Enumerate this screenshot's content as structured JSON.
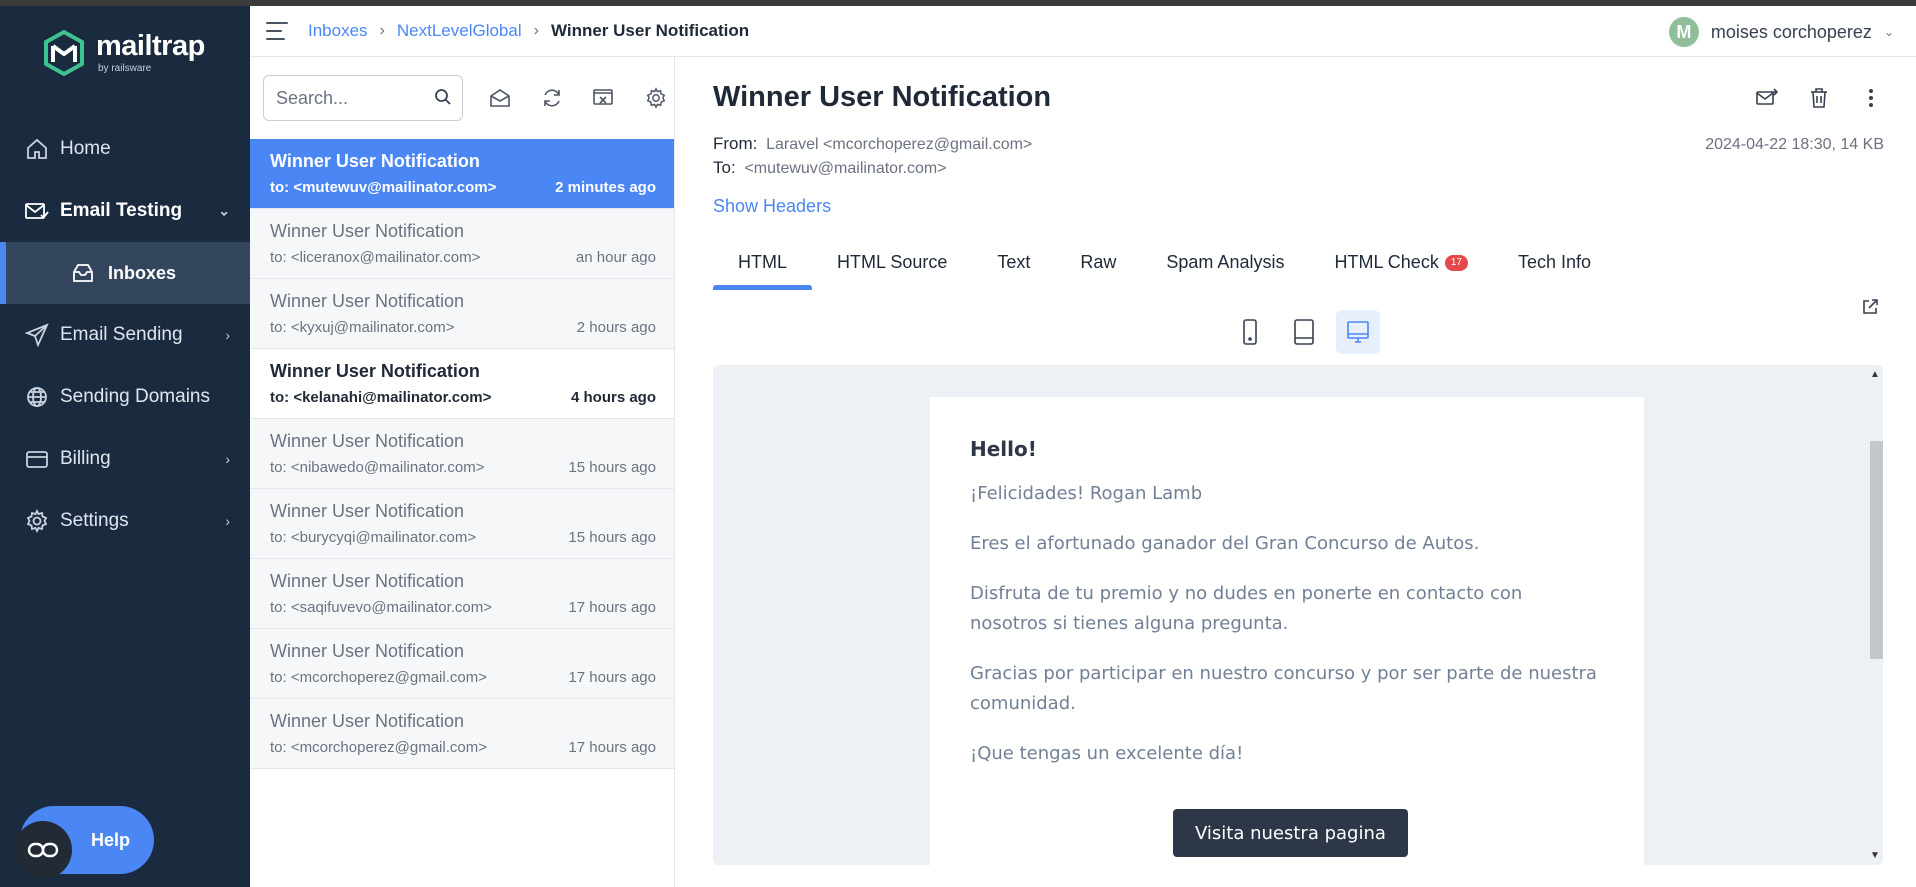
{
  "brand": {
    "name": "mailtrap",
    "sub": "by railsware",
    "accent": "#4a87f5",
    "sidebar_bg": "#1b2b3f"
  },
  "sidebar": {
    "items": [
      {
        "label": "Home",
        "icon": "home-icon"
      },
      {
        "label": "Email Testing",
        "icon": "email-testing-icon",
        "expanded": true
      },
      {
        "label": "Inboxes",
        "icon": "inbox-icon",
        "active": true
      },
      {
        "label": "Email Sending",
        "icon": "send-icon"
      },
      {
        "label": "Sending Domains",
        "icon": "globe-icon"
      },
      {
        "label": "Billing",
        "icon": "billing-icon"
      },
      {
        "label": "Settings",
        "icon": "gear-icon"
      }
    ],
    "help_label": "Help"
  },
  "header": {
    "breadcrumb": [
      "Inboxes",
      "NextLevelGlobal",
      "Winner User Notification"
    ],
    "user_initial": "M",
    "user_name": "moises corchoperez"
  },
  "list": {
    "search_placeholder": "Search...",
    "messages": [
      {
        "subject": "Winner User Notification",
        "to": "to: <mutewuv@mailinator.com>",
        "time": "2 minutes ago",
        "state": "selected"
      },
      {
        "subject": "Winner User Notification",
        "to": "to: <liceranox@mailinator.com>",
        "time": "an hour ago",
        "state": "read"
      },
      {
        "subject": "Winner User Notification",
        "to": "to: <kyxuj@mailinator.com>",
        "time": "2 hours ago",
        "state": "read"
      },
      {
        "subject": "Winner User Notification",
        "to": "to: <kelanahi@mailinator.com>",
        "time": "4 hours ago",
        "state": "unread"
      },
      {
        "subject": "Winner User Notification",
        "to": "to: <nibawedo@mailinator.com>",
        "time": "15 hours ago",
        "state": "read"
      },
      {
        "subject": "Winner User Notification",
        "to": "to: <burycyqi@mailinator.com>",
        "time": "15 hours ago",
        "state": "read"
      },
      {
        "subject": "Winner User Notification",
        "to": "to: <saqifuvevo@mailinator.com>",
        "time": "17 hours ago",
        "state": "read"
      },
      {
        "subject": "Winner User Notification",
        "to": "to: <mcorchoperez@gmail.com>",
        "time": "17 hours ago",
        "state": "read"
      },
      {
        "subject": "Winner User Notification",
        "to": "to: <mcorchoperez@gmail.com>",
        "time": "17 hours ago",
        "state": "read"
      }
    ]
  },
  "detail": {
    "title": "Winner User Notification",
    "from_label": "From:",
    "from_value": "Laravel <mcorchoperez@gmail.com>",
    "to_label": "To:",
    "to_value": "<mutewuv@mailinator.com>",
    "meta": "2024-04-22 18:30, 14 KB",
    "show_headers": "Show Headers",
    "tabs": [
      "HTML",
      "HTML Source",
      "Text",
      "Raw",
      "Spam Analysis",
      "HTML Check",
      "Tech Info"
    ],
    "html_check_badge": "17",
    "active_tab": "HTML"
  },
  "email": {
    "hello": "Hello!",
    "paragraphs": [
      "¡Felicidades! Rogan Lamb",
      "Eres el afortunado ganador del Gran Concurso de Autos.",
      "Disfruta de tu premio y no dudes en ponerte en contacto con nosotros si tienes alguna pregunta.",
      "Gracias por participar en nuestro concurso y por ser parte de nuestra comunidad.",
      "¡Que tengas un excelente día!"
    ],
    "button": "Visita nuestra pagina"
  }
}
